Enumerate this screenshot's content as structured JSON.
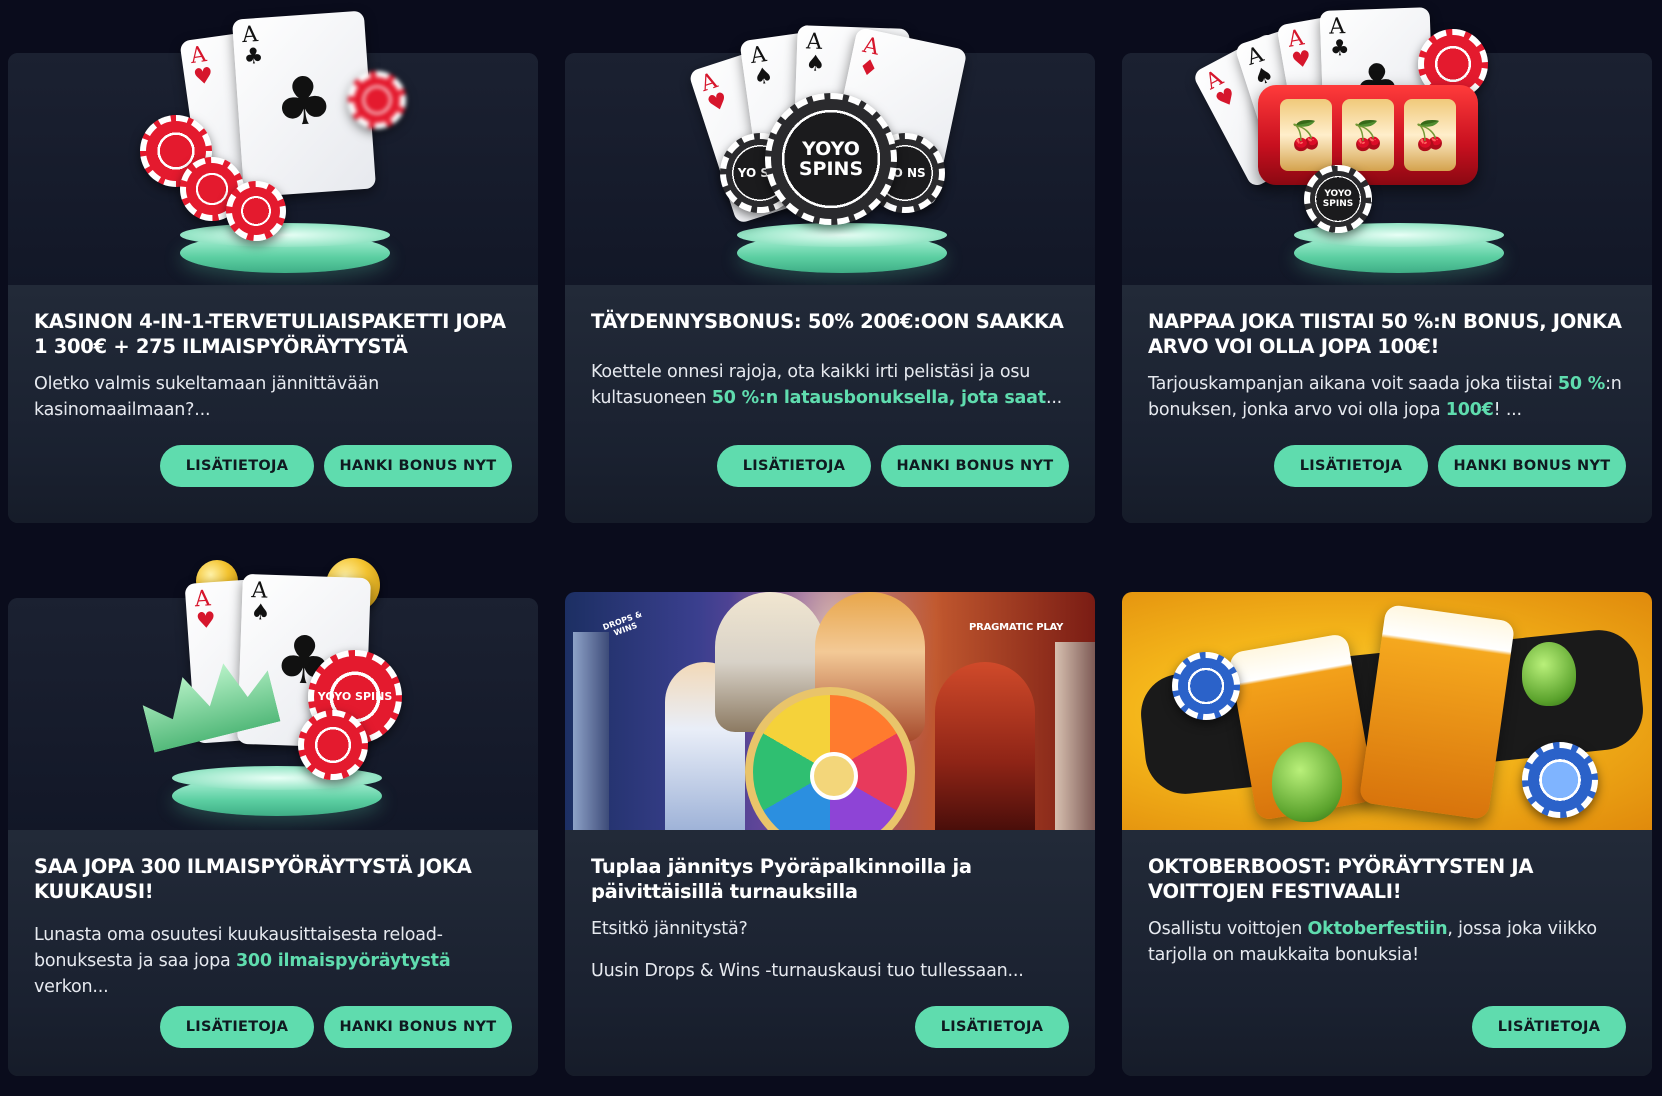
{
  "colors": {
    "page_bg": "#0a0c1c",
    "card_bg": "#1d2432",
    "accent": "#5fdcae",
    "button_text": "#0f1a20",
    "text": "#ffffff"
  },
  "buttons": {
    "info_label": "LISÄTIETOJA",
    "claim_label": "HANKI BONUS NYT"
  },
  "cards": [
    {
      "title": "KASINON 4-IN-1-TERVETULIAISPAKETTI JOPA 1 300€ + 275 ILMAISPYÖRÄYTYSTÄ",
      "desc": "Oletko valmis sukeltamaan jännittävään kasinomaailmaan?...",
      "art": "cards-chips-icon"
    },
    {
      "title": "TÄYDENNYSBONUS: 50% 200€:OON SAAKKA",
      "desc_a": "Koettele onnesi rajoja, ota kaikki irti pelistäsi ja osu kultasuoneen ",
      "desc_hl": "50 %:n latausbonuksella, jota saat",
      "desc_b": "...",
      "chip_text": "YOYO SPINS",
      "chip_left": "YO SPI",
      "chip_right": "YO NS",
      "art": "yoyo-chips-icon"
    },
    {
      "title": "NAPPAA JOKA TIISTAI 50 %:N BONUS, JONKA ARVO VOI OLLA JOPA 100€!",
      "desc_a": "Tarjouskampanjan aikana voit saada joka tiistai ",
      "desc_hl1": "50 %",
      "desc_b": ":n bonuksen, jonka arvo voi olla jopa ",
      "desc_hl2": "100€",
      "desc_c": "! ...",
      "chip_text": "YOYO SPINS",
      "art": "slot-machine-icon"
    },
    {
      "title": "SAA JOPA 300 ILMAISPYÖRÄYTYSTÄ JOKA KUUKAUSI!",
      "desc_a": "Lunasta oma osuutesi kuukausittaisesta reload-bonuksesta ja saa jopa ",
      "desc_hl": "300 ilmaispyöräytystä",
      "desc_b": " verkon...",
      "chip_text": "YOYO SPINS",
      "art": "crown-cards-icon"
    },
    {
      "title": "Tuplaa jännitys Pyöräpalkinnoilla ja päivittäisillä turnauksilla",
      "desc1": "Etsitkö jännitystä?",
      "desc2": "Uusin Drops & Wins -turnauskausi tuo tullessaan...",
      "badge_left": "DROPS & WINS",
      "badge_right": "PRAGMATIC PLAY",
      "art": "prize-wheel-gods-image"
    },
    {
      "title": "OKTOBERBOOST: PYÖRÄYTYSTEN JA VOITTOJEN FESTIVAALI!",
      "desc_a": "Osallistu voittojen ",
      "desc_hl": "Oktoberfestiin",
      "desc_b": ", jossa joka viikko tarjolla on maukkaita bonuksia!",
      "art": "beer-mugs-image"
    }
  ]
}
